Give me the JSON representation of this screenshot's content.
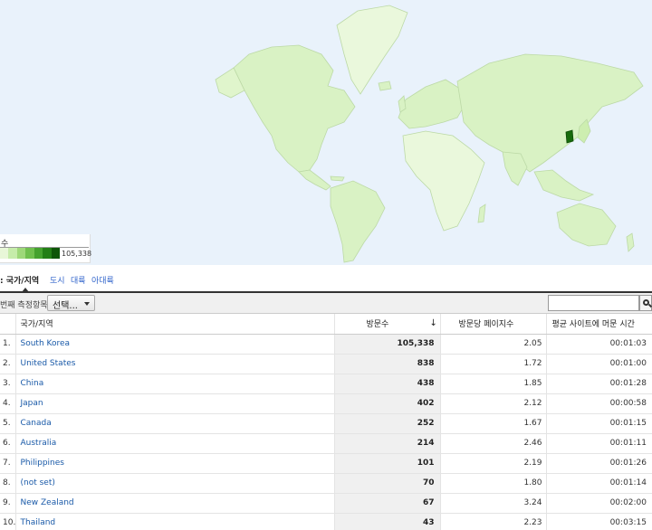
{
  "colors": {
    "ocean": "#e9f2fb",
    "land_low": "#e2f5cf",
    "land_mid": "#cfeeb4",
    "land_high": "#176b0c",
    "link": "#1a5aa8"
  },
  "legend": {
    "title": "수",
    "max_value": "105,338",
    "swatches": [
      "#e8f7d8",
      "#c6ecaa",
      "#9ed879",
      "#70c04e",
      "#45a22f",
      "#237f16",
      "#0e5608"
    ]
  },
  "tabs": [
    {
      "label": ": 국가/지역",
      "active": true
    },
    {
      "label": "도시",
      "active": false
    },
    {
      "label": "대륙",
      "active": false
    },
    {
      "label": "아대륙",
      "active": false
    }
  ],
  "toolbar": {
    "secondary_label": "번째 측정항목",
    "select_label": "선택...",
    "search_placeholder": "",
    "search_icon": "search-icon"
  },
  "table": {
    "headers": {
      "country": "국가/지역",
      "visits": "방문수",
      "sort_icon": "↓",
      "pages_per_visit": "방문당 페이지수",
      "avg_time": "평균 사이트에 머문 시간"
    },
    "rows": [
      {
        "rank": "1.",
        "country": "South Korea",
        "visits": "105,338",
        "ppv": "2.05",
        "time": "00:01:03"
      },
      {
        "rank": "2.",
        "country": "United States",
        "visits": "838",
        "ppv": "1.72",
        "time": "00:01:00"
      },
      {
        "rank": "3.",
        "country": "China",
        "visits": "438",
        "ppv": "1.85",
        "time": "00:01:28"
      },
      {
        "rank": "4.",
        "country": "Japan",
        "visits": "402",
        "ppv": "2.12",
        "time": "00:00:58"
      },
      {
        "rank": "5.",
        "country": "Canada",
        "visits": "252",
        "ppv": "1.67",
        "time": "00:01:15"
      },
      {
        "rank": "6.",
        "country": "Australia",
        "visits": "214",
        "ppv": "2.46",
        "time": "00:01:11"
      },
      {
        "rank": "7.",
        "country": "Philippines",
        "visits": "101",
        "ppv": "2.19",
        "time": "00:01:26"
      },
      {
        "rank": "8.",
        "country": "(not set)",
        "visits": "70",
        "ppv": "1.80",
        "time": "00:01:14"
      },
      {
        "rank": "9.",
        "country": "New Zealand",
        "visits": "67",
        "ppv": "3.24",
        "time": "00:02:00"
      },
      {
        "rank": "10.",
        "country": "Thailand",
        "visits": "43",
        "ppv": "2.23",
        "time": "00:03:15"
      }
    ]
  }
}
